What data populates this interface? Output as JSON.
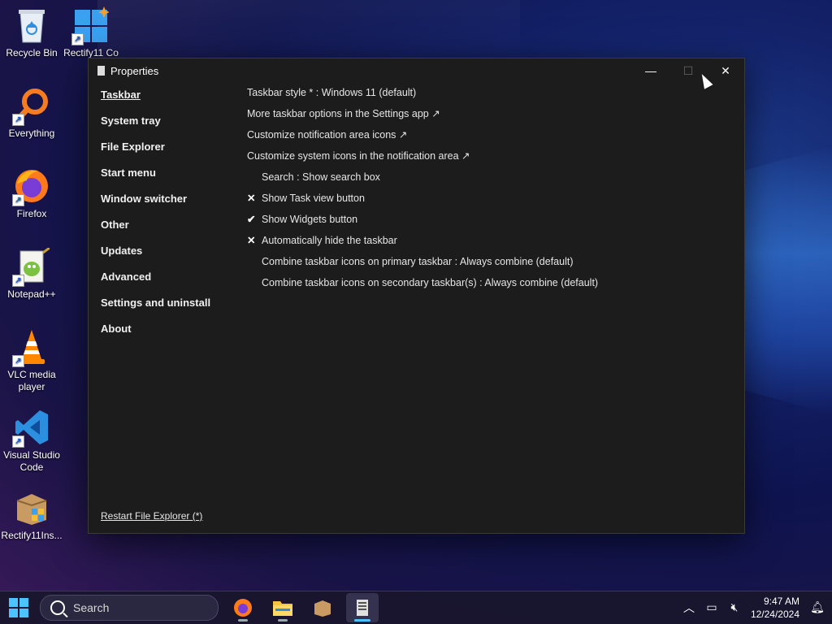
{
  "desktop": {
    "icons": [
      {
        "label": "Recycle Bin"
      },
      {
        "label": "Rectify11 Co"
      },
      {
        "label": "Everything"
      },
      {
        "label": "Firefox"
      },
      {
        "label": "Notepad++"
      },
      {
        "label": "VLC media player"
      },
      {
        "label": "Visual Studio Code"
      },
      {
        "label": "Rectify11Ins..."
      }
    ]
  },
  "window": {
    "title": "Properties",
    "controls": {
      "minimize": "—",
      "maximize": "☐",
      "close": "✕"
    },
    "sidebar": [
      {
        "label": "Taskbar",
        "active": true
      },
      {
        "label": "System tray"
      },
      {
        "label": "File Explorer"
      },
      {
        "label": "Start menu"
      },
      {
        "label": "Window switcher"
      },
      {
        "label": "Other"
      },
      {
        "label": "Updates"
      },
      {
        "label": "Advanced"
      },
      {
        "label": "Settings and uninstall"
      },
      {
        "label": "About"
      }
    ],
    "settings": [
      {
        "mark": "",
        "label": "Taskbar style * : Windows 11 (default)",
        "indent": false
      },
      {
        "mark": "",
        "label": "More taskbar options in the Settings app ↗",
        "indent": false
      },
      {
        "mark": "",
        "label": "Customize notification area icons ↗",
        "indent": false
      },
      {
        "mark": "",
        "label": "Customize system icons in the notification area ↗",
        "indent": false
      },
      {
        "mark": "",
        "label": "Search : Show search box",
        "indent": true
      },
      {
        "mark": "✕",
        "label": "Show Task view button",
        "indent": true
      },
      {
        "mark": "✔",
        "label": "Show Widgets button",
        "indent": true
      },
      {
        "mark": "✕",
        "label": "Automatically hide the taskbar",
        "indent": true
      },
      {
        "mark": "",
        "label": "Combine taskbar icons on primary taskbar : Always combine (default)",
        "indent": true
      },
      {
        "mark": "",
        "label": "Combine taskbar icons on secondary taskbar(s) : Always combine (default)",
        "indent": true
      }
    ],
    "restart_link": "Restart File Explorer (*)"
  },
  "taskbar": {
    "search_placeholder": "Search",
    "time": "9:47 AM",
    "date": "12/24/2024",
    "accent": "#4cc2ff"
  }
}
